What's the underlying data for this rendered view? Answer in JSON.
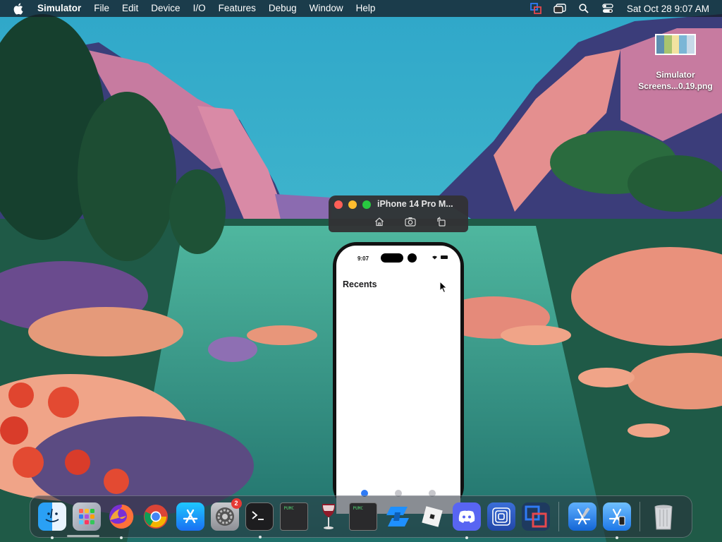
{
  "menubar": {
    "app_name": "Simulator",
    "items": [
      "File",
      "Edit",
      "Device",
      "I/O",
      "Features",
      "Debug",
      "Window",
      "Help"
    ],
    "clock": "Sat Oct 28  9:07 AM",
    "status_icons": [
      "screen-share-icon",
      "stage-manager-icon",
      "search-icon",
      "control-center-icon"
    ]
  },
  "desktop_file": {
    "name_line1": "Simulator",
    "name_line2": "Screens...0.19.png"
  },
  "simulator": {
    "window_title": "iPhone 14 Pro M...",
    "toolbar": [
      "home-icon",
      "screenshot-icon",
      "rotate-icon"
    ],
    "colors": {
      "close": "#ff5f57",
      "minimize": "#febc2e",
      "zoom": "#28c840"
    },
    "device": {
      "status_time": "9:07",
      "screen_title": "Recents",
      "tab_colors": [
        "#2f7bf5",
        "#c7c7cc",
        "#c7c7cc"
      ]
    }
  },
  "dock": {
    "apps": [
      {
        "name": "finder-icon",
        "running": true
      },
      {
        "name": "launchpad-icon",
        "running": false
      },
      {
        "name": "firefox-icon",
        "running": true
      },
      {
        "name": "chrome-icon",
        "running": false
      },
      {
        "name": "app-store-icon",
        "running": false
      },
      {
        "name": "system-settings-icon",
        "running": false,
        "badge": "2"
      },
      {
        "name": "terminal-icon",
        "running": true
      },
      {
        "name": "terminal-2-icon",
        "running": false,
        "label": "PUMC"
      },
      {
        "name": "wine-icon",
        "running": false
      },
      {
        "name": "terminal-3-icon",
        "running": false,
        "label": "PUMC"
      },
      {
        "name": "blue-app-icon",
        "running": false
      },
      {
        "name": "roblox-icon",
        "running": false
      },
      {
        "name": "discord-icon",
        "running": true
      },
      {
        "name": "concentric-app-icon",
        "running": false
      },
      {
        "name": "parallels-icon",
        "running": false
      },
      {
        "name": "xcode-icon",
        "running": false
      },
      {
        "name": "simulator-icon",
        "running": true
      },
      {
        "name": "trash-icon",
        "running": false
      }
    ]
  }
}
